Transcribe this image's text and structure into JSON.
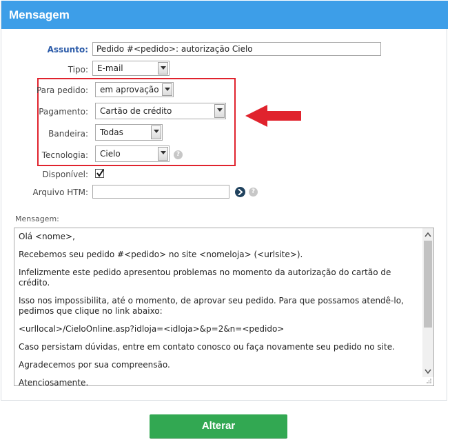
{
  "header": {
    "title": "Mensagem"
  },
  "form": {
    "assunto": {
      "label": "Assunto:",
      "value": "Pedido #<pedido>: autorização Cielo"
    },
    "tipo": {
      "label": "Tipo:",
      "value": "E-mail"
    },
    "para_pedido": {
      "label": "Para pedido:",
      "value": "em aprovação"
    },
    "pagamento": {
      "label": "Pagamento:",
      "value": "Cartão de crédito"
    },
    "bandeira": {
      "label": "Bandeira:",
      "value": "Todas"
    },
    "tecnologia": {
      "label": "Tecnologia:",
      "value": "Cielo",
      "help": "?"
    },
    "disponivel": {
      "label": "Disponível:",
      "checked": true
    },
    "arquivo_htm": {
      "label": "Arquivo HTM:",
      "value": "",
      "help": "?"
    }
  },
  "mensagem": {
    "label": "Mensagem:",
    "lines": [
      "Olá <nome>,",
      "Recebemos seu pedido #<pedido> no site <nomeloja> (<urlsite>).",
      "Infelizmente este pedido apresentou problemas no momento da autorização do cartão de crédito.",
      "Isso nos impossibilita, até o momento, de aprovar seu pedido. Para que possamos atendê-lo, pedimos que clique no link abaixo:",
      "<urllocal>/CieloOnline.asp?idloja=<idloja>&p=2&n=<pedido>",
      "Caso persistam dúvidas, entre em contato conosco ou faça novamente seu pedido no site.",
      "Agradecemos por sua compreensão.",
      "Atenciosamente,"
    ]
  },
  "actions": {
    "submit_label": "Alterar"
  },
  "colors": {
    "header": "#3d9ee8",
    "highlight": "#e0232d",
    "submit": "#32a852"
  },
  "icons": [
    "dropdown-arrow-icon",
    "help-icon",
    "go-arrow-icon",
    "checkmark-icon",
    "red-arrow-icon",
    "resize-grip-icon"
  ]
}
